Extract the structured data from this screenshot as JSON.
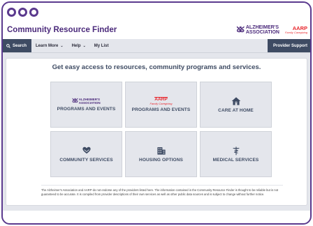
{
  "window": {
    "controls": [
      "",
      "",
      ""
    ]
  },
  "header": {
    "title": "Community Resource Finder",
    "alz_logo": {
      "line1": "ALZHEIMER'S",
      "line2": "ASSOCIATION"
    },
    "aarp_logo": {
      "name": "AARP",
      "tagline": "Family Caregiving"
    }
  },
  "nav": {
    "search": "Search",
    "items": [
      {
        "label": "Learn More",
        "has_dropdown": true
      },
      {
        "label": "Help",
        "has_dropdown": true
      },
      {
        "label": "My List",
        "has_dropdown": false
      }
    ],
    "support": "Provider Support"
  },
  "main": {
    "headline": "Get easy access to resources, community programs and services.",
    "tiles": [
      {
        "label": "PROGRAMS AND EVENTS",
        "icon": "alzheimers-logo-icon"
      },
      {
        "label": "PROGRAMS AND EVENTS",
        "icon": "aarp-logo-icon"
      },
      {
        "label": "CARE AT HOME",
        "icon": "home-icon"
      },
      {
        "label": "COMMUNITY SERVICES",
        "icon": "heart-hands-icon"
      },
      {
        "label": "HOUSING OPTIONS",
        "icon": "building-icon"
      },
      {
        "label": "MEDICAL SERVICES",
        "icon": "caduceus-icon"
      }
    ],
    "disclaimer": "The Alzheimer's Association and AARP do not endorse any of the providers listed here. The information contained in the Community Resource Finder is thought to be reliable but is not guaranteed to be accurate. It is compiled from provider descriptions of their own services as well as other public data sources and is subject to change without further notice."
  },
  "colors": {
    "brand_purple": "#4b2a7b",
    "nav_dark": "#3e4b63",
    "aarp_red": "#e8262c",
    "tile_bg": "#e4e6ec"
  }
}
